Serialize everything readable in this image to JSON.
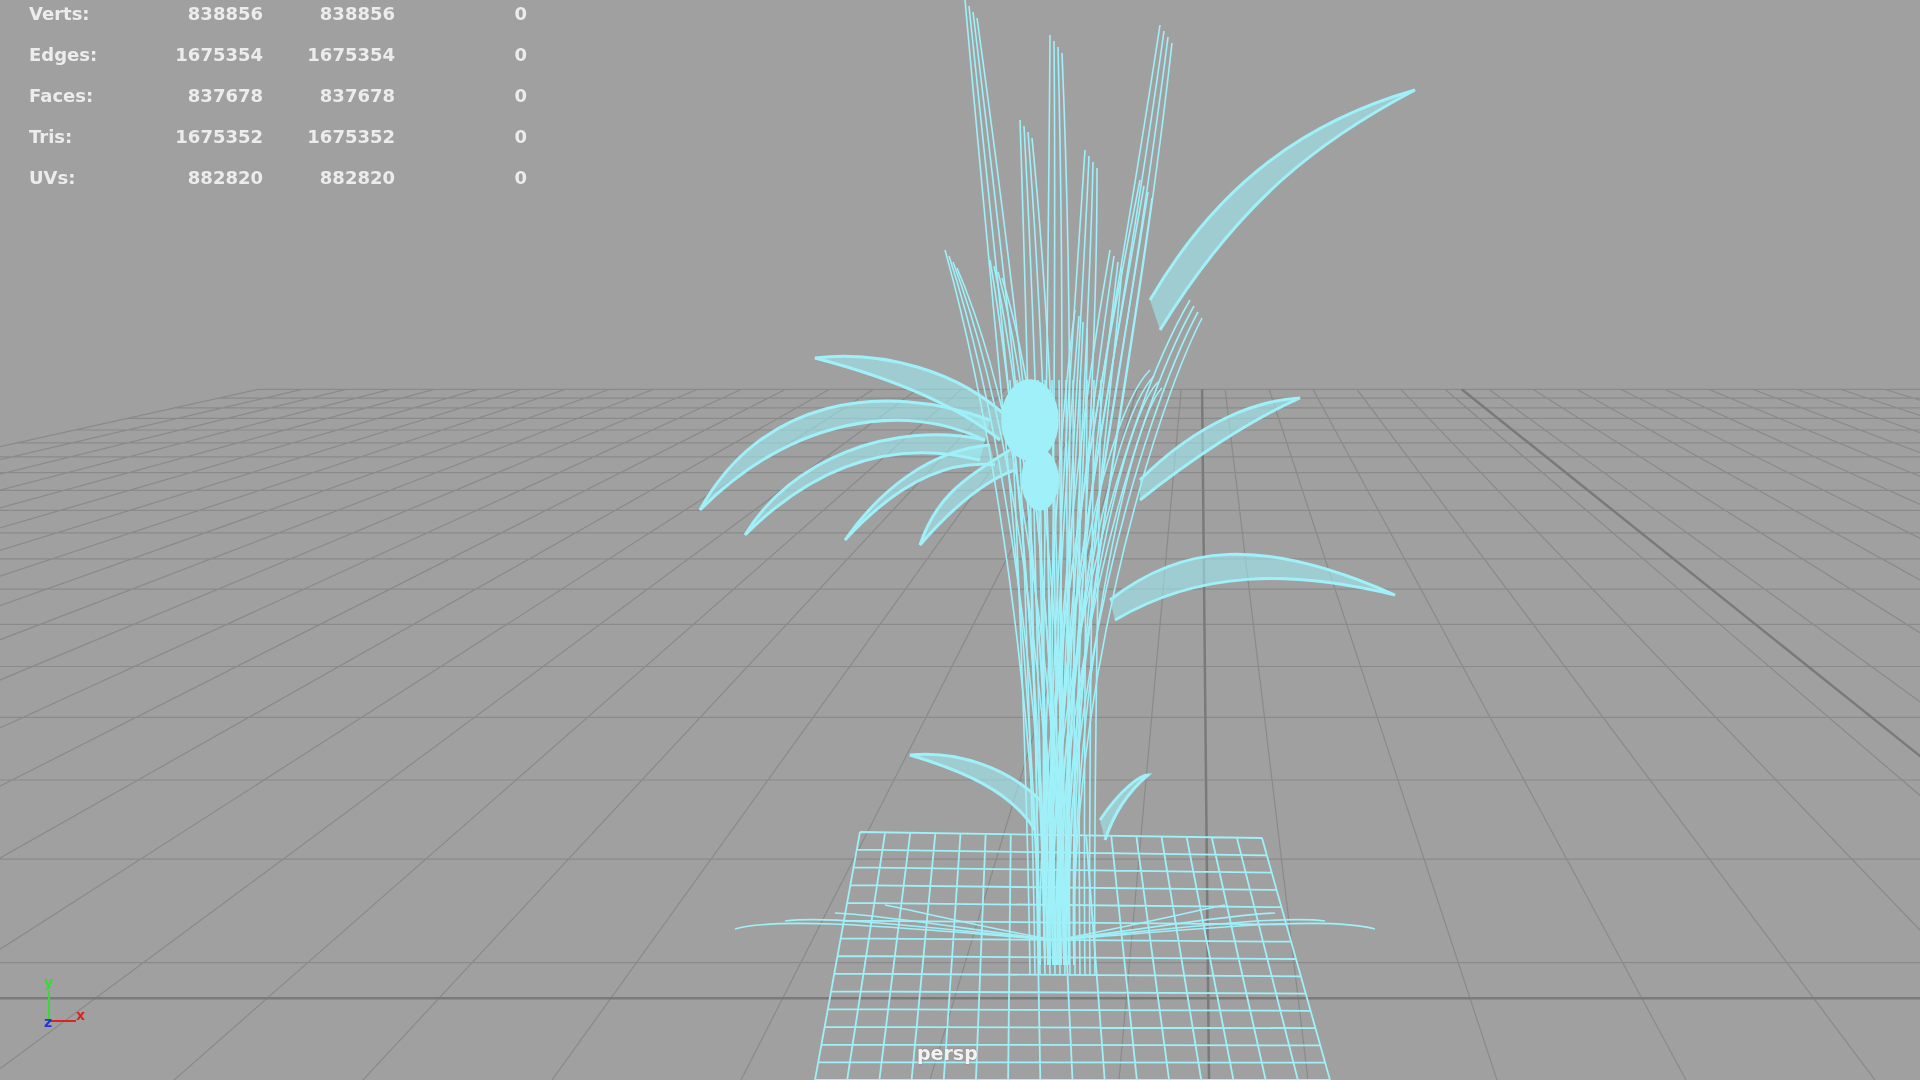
{
  "stats": [
    {
      "label": "Verts:",
      "values": [
        "838856",
        "838856",
        "0"
      ]
    },
    {
      "label": "Edges:",
      "values": [
        "1675354",
        "1675354",
        "0"
      ]
    },
    {
      "label": "Faces:",
      "values": [
        "837678",
        "837678",
        "0"
      ]
    },
    {
      "label": "Tris:",
      "values": [
        "1675352",
        "1675352",
        "0"
      ]
    },
    {
      "label": "UVs:",
      "values": [
        "882820",
        "882820",
        "0"
      ]
    }
  ],
  "axis_gizmo": {
    "x_label": "x",
    "y_label": "y",
    "z_label": "z"
  },
  "camera_label": "persp"
}
